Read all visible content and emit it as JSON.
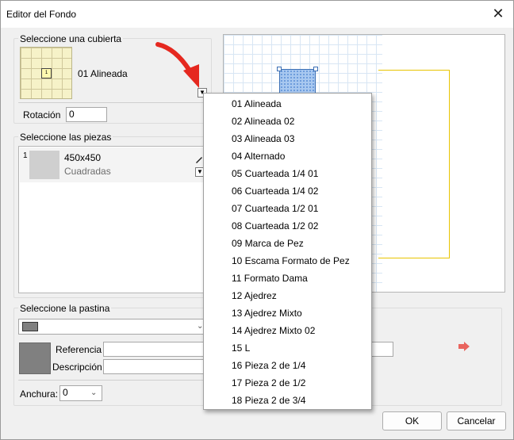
{
  "window": {
    "title": "Editor del Fondo"
  },
  "cover": {
    "group_label": "Seleccione una cubierta",
    "selected_name": "01 Alineada",
    "thumb_number": "1",
    "rotation_label": "Rotación",
    "rotation_value": "0"
  },
  "pieces": {
    "group_label": "Seleccione las piezas",
    "items": [
      {
        "index": "1",
        "size": "450x450",
        "type": "Cuadradas"
      }
    ]
  },
  "grout": {
    "group_label": "Seleccione la pastina",
    "reference_label": "Referencia",
    "description_label": "Descripción",
    "reference_value": "",
    "description_value": "",
    "width_label": "Anchura:",
    "width_value": "0",
    "swatch_color": "#808080"
  },
  "dropdown": {
    "items": [
      "01 Alineada",
      "02 Alineada 02",
      "03 Alineada 03",
      "04 Alternado",
      "05 Cuarteada 1/4 01",
      "06 Cuarteada 1/4 02",
      "07 Cuarteada 1/2 01",
      "08 Cuarteada 1/2 02",
      "09 Marca de Pez",
      "10 Escama Formato de Pez",
      "11 Formato Dama",
      "12 Ajedrez",
      "13 Ajedrez Mixto",
      "14 Ajedrez Mixto 02",
      "15 L",
      "16 Pieza 2 de 1/4",
      "17 Pieza 2 de 1/2",
      "18 Pieza 2 de 3/4"
    ]
  },
  "buttons": {
    "ok": "OK",
    "cancel": "Cancelar"
  },
  "colors": {
    "accent_red": "#e5281f",
    "preview_yellow": "#e8c400",
    "tile_blue": "#a8c8f0"
  }
}
